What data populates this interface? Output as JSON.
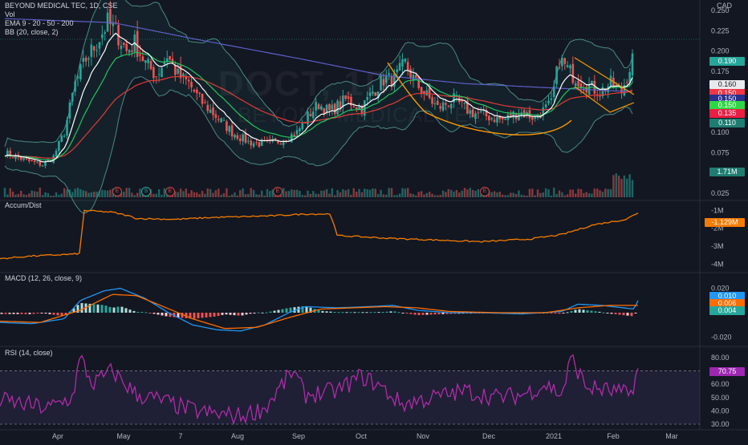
{
  "header": {
    "title": "BEYOND MEDICAL TEC, 1D, CSE",
    "vol": "Vol",
    "ema": "EMA 9 - 20 - 50 - 200",
    "bb": "BB (20, close, 2)",
    "currency": "CAD"
  },
  "watermark": {
    "symbol": "DOCT, 1D",
    "name": "BEYOND MEDICAL TEC"
  },
  "panes": {
    "accum_title": "Accum/Dist",
    "macd_title": "MACD (12, 26, close, 9)",
    "rsi_title": "RSI (14, close)"
  },
  "price_axis": [
    "0.250",
    "0.225",
    "0.200",
    "0.175",
    "0.150",
    "0.125",
    "0.100",
    "0.075",
    "0.050",
    "0.025"
  ],
  "badges": [
    {
      "label": "0.190",
      "color": "#26a69a"
    },
    {
      "label": "0.160",
      "color": "#e8eaed",
      "text": "#131722"
    },
    {
      "label": "0.150",
      "color": "#f23645"
    },
    {
      "label": "0.150",
      "color": "#2a2e8c"
    },
    {
      "label": "0.150",
      "color": "#2fd643"
    },
    {
      "label": "0.135",
      "color": "#e91e43"
    },
    {
      "label": "0.110",
      "color": "#1e7d72"
    },
    {
      "label": "1.71M",
      "color": "#1e7d72"
    }
  ],
  "ad_axis": [
    "-1M",
    "-2M",
    "-3M",
    "-4M"
  ],
  "ad_badge": "-1.129M",
  "macd_axis": [
    "0.020",
    "0.000",
    "-0.020"
  ],
  "macd_badges": [
    {
      "label": "0.010",
      "color": "#2196f3"
    },
    {
      "label": "0.006",
      "color": "#ff6d00"
    },
    {
      "label": "0.004",
      "color": "#26a69a"
    }
  ],
  "rsi_axis": [
    "80.00",
    "70.00",
    "60.00",
    "50.00",
    "40.00",
    "30.00"
  ],
  "rsi_badge": "70.75",
  "earnings_markers": [
    "E",
    "S",
    "E",
    "E",
    "E"
  ],
  "x_labels": [
    "Apr",
    "May",
    "7",
    "Aug",
    "Sep",
    "Oct",
    "Nov",
    "Dec",
    "2021",
    "Feb",
    "Mar"
  ],
  "colors": {
    "up": "#26a69a",
    "down": "#ef5350",
    "ema9": "#ffffff",
    "ema20": "#22c55e",
    "ema50": "#e53935",
    "ema200": "#5c5fc9",
    "bb": "#4a8a84",
    "ad": "#f57c00",
    "macd": "#2196f3",
    "signal": "#ff6d00",
    "rsi": "#b02ca8"
  },
  "chart_data": [
    {
      "type": "candlestick",
      "title": "BEYOND MEDICAL TEC, 1D, CSE",
      "ylabel": "CAD",
      "ylim": [
        0.02,
        0.255
      ],
      "x": [
        "Apr",
        "May",
        "7",
        "Aug",
        "Sep",
        "Oct",
        "Nov",
        "Dec",
        "2021",
        "Feb"
      ],
      "series": [
        {
          "name": "Close",
          "values": [
            0.06,
            0.23,
            0.17,
            0.085,
            0.11,
            0.165,
            0.12,
            0.115,
            0.16,
            0.19
          ]
        },
        {
          "name": "EMA 200",
          "values": [
            0.24,
            0.235,
            0.215,
            0.19,
            0.17,
            0.16,
            0.158,
            0.155,
            0.15,
            0.15
          ]
        }
      ],
      "last": {
        "close": 0.19,
        "ema9": 0.16,
        "ema20": 0.15,
        "ema50": 0.135,
        "bb_lower": 0.11,
        "volume": "1.71M"
      }
    },
    {
      "type": "line",
      "title": "Accum/Dist",
      "ylim": [
        -4.3,
        -0.8
      ],
      "x": [
        "Apr",
        "May",
        "7",
        "Aug",
        "Sep",
        "Oct",
        "Nov",
        "Dec",
        "2021",
        "Feb"
      ],
      "values": [
        -3.6,
        -1.0,
        -1.4,
        -1.45,
        -1.3,
        -2.4,
        -2.65,
        -2.65,
        -2.3,
        -1.129
      ]
    },
    {
      "type": "line",
      "title": "MACD (12, 26, close, 9)",
      "ylim": [
        -0.025,
        0.025
      ],
      "x": [
        "Apr",
        "May",
        "7",
        "Aug",
        "Sep",
        "Oct",
        "Nov",
        "Dec",
        "2021",
        "Feb"
      ],
      "series": [
        {
          "name": "MACD",
          "values": [
            -0.008,
            0.019,
            0.0,
            -0.014,
            -0.005,
            0.005,
            0.002,
            0.0,
            0.006,
            0.01
          ]
        },
        {
          "name": "Signal",
          "values": [
            -0.007,
            0.015,
            0.004,
            -0.013,
            -0.008,
            0.003,
            0.002,
            0.0,
            0.004,
            0.006
          ]
        }
      ]
    },
    {
      "type": "line",
      "title": "RSI (14, close)",
      "ylim": [
        27,
        86
      ],
      "x": [
        "Apr",
        "May",
        "7",
        "Aug",
        "Sep",
        "Oct",
        "Nov",
        "Dec",
        "2021",
        "Feb"
      ],
      "values": [
        48,
        80,
        45,
        36,
        58,
        66,
        45,
        50,
        60,
        70.75
      ]
    }
  ]
}
